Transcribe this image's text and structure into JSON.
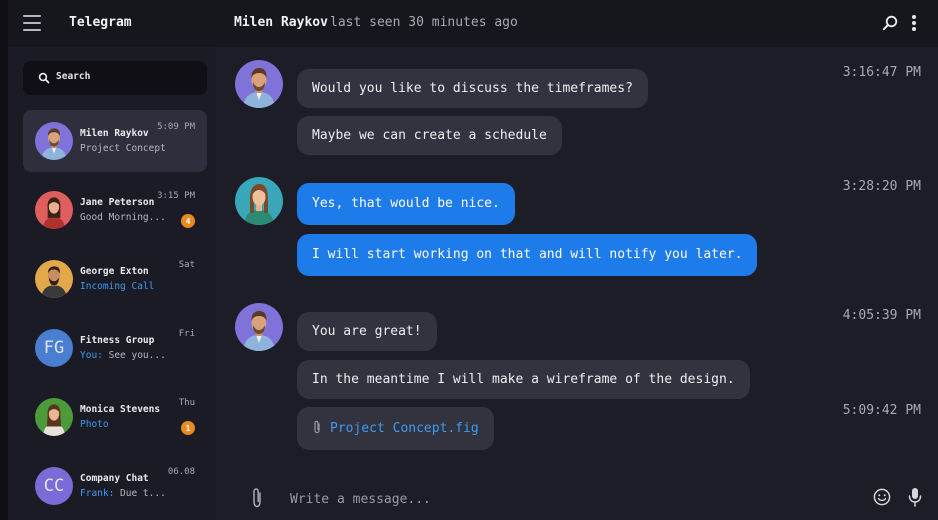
{
  "app": {
    "title": "Telegram"
  },
  "header": {
    "contact_name": "Milen Raykov",
    "status": "last seen 30 minutes ago"
  },
  "sidebar": {
    "search_label": "Search",
    "chats": [
      {
        "name": "Milen Raykov",
        "time": "5:09 PM",
        "preview": "Project Concept",
        "preview_prefix": "",
        "active": true,
        "badge": ""
      },
      {
        "name": "Jane Peterson",
        "time": "3:15 PM",
        "preview": "Good Morning...",
        "preview_prefix": "",
        "active": false,
        "badge": "4"
      },
      {
        "name": "George Exton",
        "time": "Sat",
        "preview": "Incoming Call",
        "preview_prefix": "",
        "active": false,
        "badge": ""
      },
      {
        "name": "Fitness Group",
        "time": "Fri",
        "preview": " See you...",
        "preview_prefix": "You:",
        "initials": "FG",
        "active": false,
        "badge": ""
      },
      {
        "name": "Monica Stevens",
        "time": "Thu",
        "preview": "Photo",
        "preview_prefix": "",
        "active": false,
        "badge": "1"
      },
      {
        "name": "Company Chat",
        "time": "06.08",
        "preview": " Due t...",
        "preview_prefix": "Frank:",
        "initials": "CC",
        "active": false,
        "badge": ""
      }
    ]
  },
  "messages": [
    {
      "text": "Would you like to discuss the timeframes?",
      "time": "3:16:47 PM",
      "direction": "in"
    },
    {
      "text": "Maybe we can create a schedule",
      "direction": "in"
    },
    {
      "text": "Yes, that would be nice.",
      "time": "3:28:20 PM",
      "direction": "out"
    },
    {
      "text": "I will start working on that and will notify you later.",
      "direction": "out"
    },
    {
      "text": "You are great!",
      "time": "4:05:39 PM",
      "direction": "in"
    },
    {
      "text": "In the meantime I will make a wireframe of the design.",
      "direction": "in"
    },
    {
      "text": "Project Concept.fig",
      "time": "5:09:42 PM",
      "direction": "in",
      "type": "file"
    }
  ],
  "composer": {
    "placeholder": "Write a message..."
  },
  "colors": {
    "accent": "#1e7bea",
    "link": "#3f9af0",
    "badge": "#e98a1f",
    "incoming_bubble": "#33333f",
    "background": "#1d1d27"
  }
}
